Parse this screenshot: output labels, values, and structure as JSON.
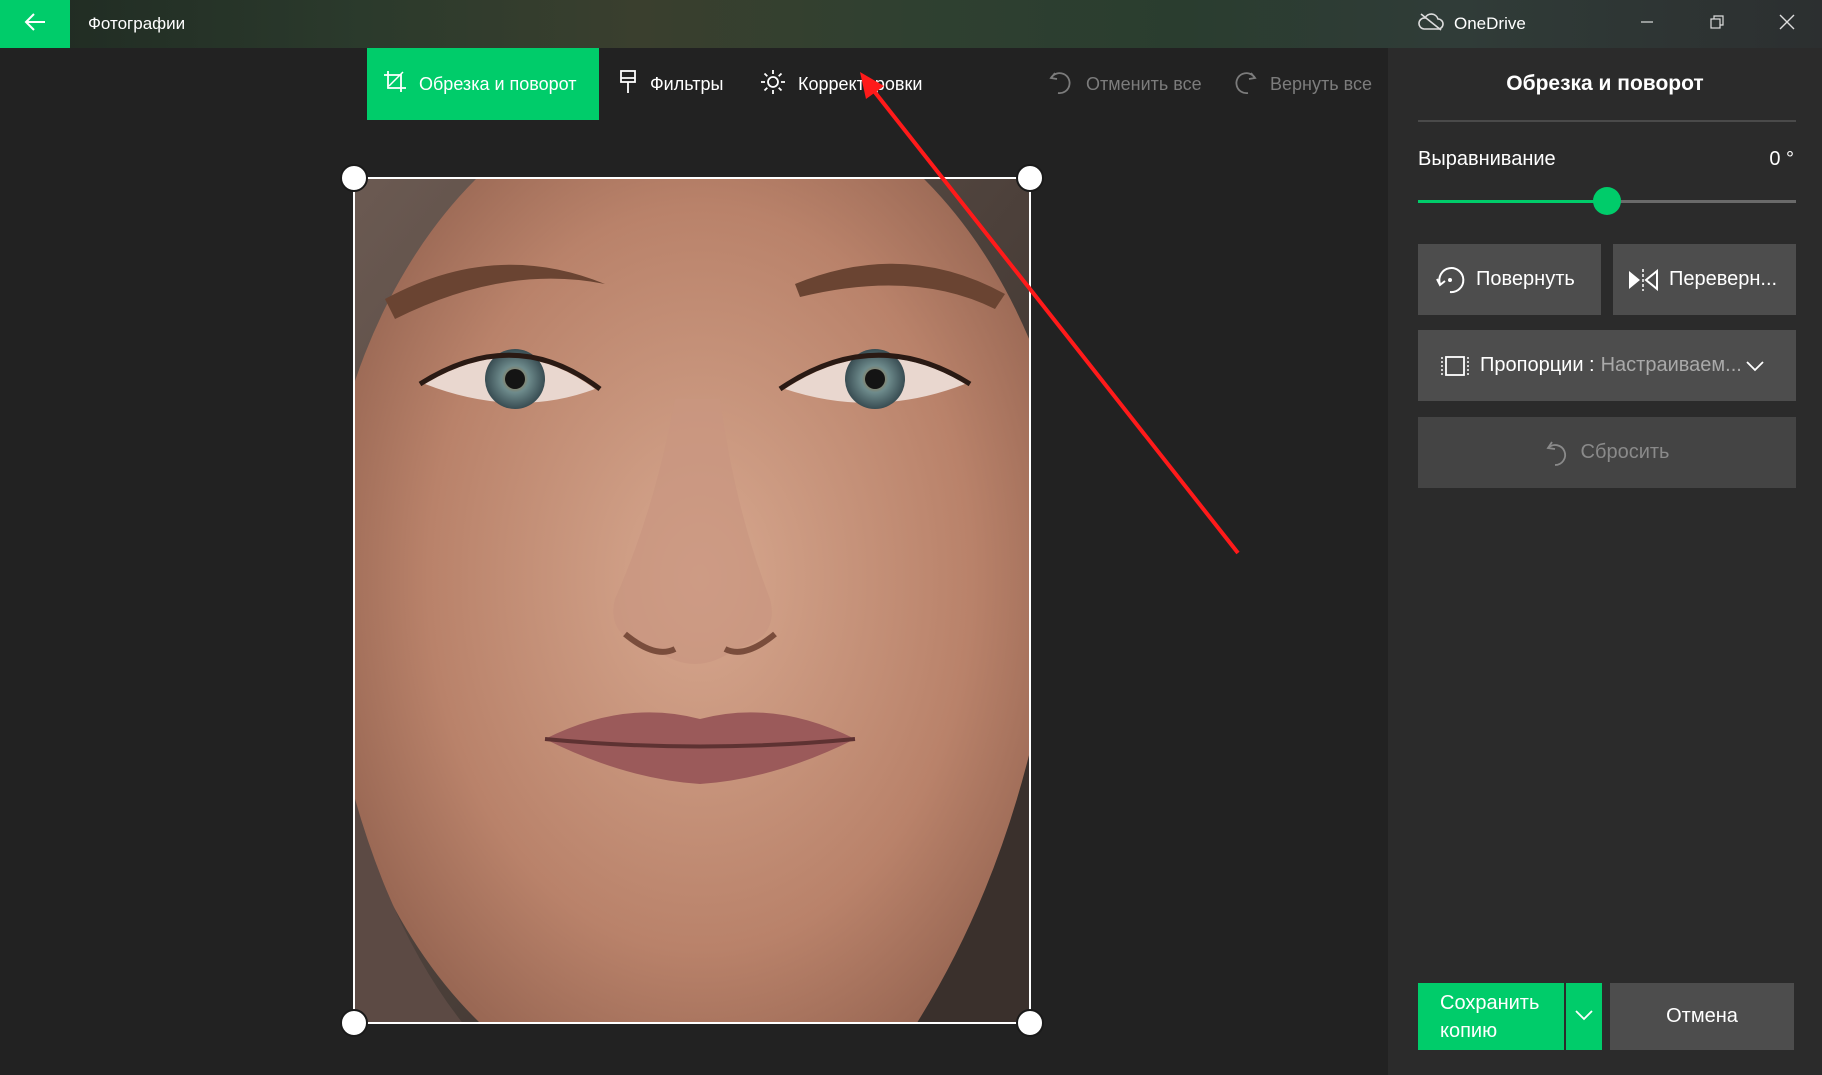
{
  "titlebar": {
    "app_title": "Фотографии",
    "onedrive_label": "OneDrive"
  },
  "toolbar": {
    "crop_label": "Обрезка и поворот",
    "filters_label": "Фильтры",
    "adjust_label": "Корректировки",
    "undo_all_label": "Отменить все",
    "redo_all_label": "Вернуть все"
  },
  "panel": {
    "title": "Обрезка и поворот",
    "straighten_label": "Выравнивание",
    "straighten_value": "0 °",
    "straighten_fraction": 0.5,
    "rotate_label": "Повернуть",
    "flip_label": "Переверн...",
    "aspect_label": "Пропорции :",
    "aspect_value": "Настраиваем...",
    "reset_label": "Сбросить"
  },
  "footer": {
    "save_label": "Сохранить копию",
    "cancel_label": "Отмена"
  },
  "colors": {
    "accent": "#00cc6a",
    "background": "#222222",
    "panel": "#2b2b2b",
    "button": "#4d4d4d",
    "annotation": "#ff1a1a"
  }
}
